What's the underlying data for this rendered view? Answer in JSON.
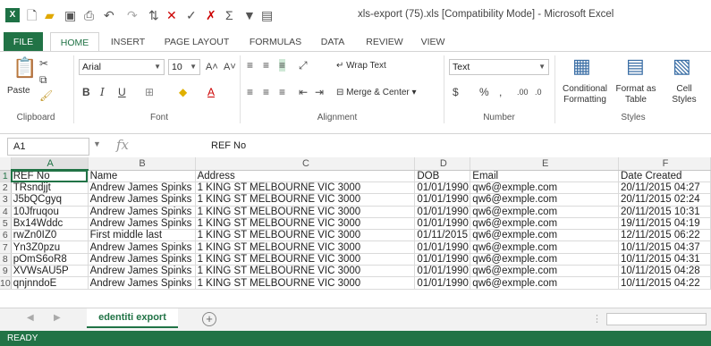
{
  "window": {
    "title": "xls-export (75).xls  [Compatibility Mode] - Microsoft Excel"
  },
  "ribbon_tabs": [
    "FILE",
    "HOME",
    "INSERT",
    "PAGE LAYOUT",
    "FORMULAS",
    "DATA",
    "REVIEW",
    "VIEW"
  ],
  "clipboard": {
    "paste": "Paste",
    "group": "Clipboard"
  },
  "font": {
    "name": "Arial",
    "size": "10",
    "bold": "B",
    "italic": "I",
    "underline": "U",
    "group": "Font"
  },
  "alignment": {
    "wrap": "Wrap Text",
    "merge": "Merge & Center",
    "group": "Alignment"
  },
  "number": {
    "format": "Text",
    "currency": "$",
    "percent": "%",
    "comma": ",",
    "group": "Number"
  },
  "styles": {
    "conditional": "Conditional",
    "conditional2": "Formatting",
    "format_table": "Format as",
    "format_table2": "Table",
    "cell": "Cell",
    "cell2": "Styles",
    "group": "Styles"
  },
  "formula_bar": {
    "name_box": "A1",
    "fx": "fx",
    "content": "REF No"
  },
  "columns": [
    "A",
    "B",
    "C",
    "D",
    "E",
    "F"
  ],
  "rows": [
    [
      "REF No",
      "Name",
      "Address",
      "DOB",
      "Email",
      "Date Created"
    ],
    [
      "TRsndjjt",
      "Andrew James Spinks",
      "1 KING ST MELBOURNE VIC 3000",
      "01/01/1990",
      "qw6@exmple.com",
      "20/11/2015 04:27"
    ],
    [
      "J5bQCgyq",
      "Andrew James Spinks",
      "1 KING ST MELBOURNE VIC 3000",
      "01/01/1990",
      "qw6@exmple.com",
      "20/11/2015 02:24"
    ],
    [
      "10Jfruqou",
      "Andrew James Spinks",
      "1 KING ST MELBOURNE VIC 3000",
      "01/01/1990",
      "qw6@exmple.com",
      "20/11/2015 10:31"
    ],
    [
      "Bx14Wddc",
      "Andrew James Spinks",
      "1 KING ST MELBOURNE VIC 3000",
      "01/01/1990",
      "qw6@exmple.com",
      "19/11/2015 04:19"
    ],
    [
      "rwZn0IZ0",
      "First middle last",
      "1 KING ST MELBOURNE VIC 3000",
      "01/11/2015",
      "qw6@exmple.com",
      "12/11/2015 06:22"
    ],
    [
      "Yn3Z0pzu",
      "Andrew James Spinks",
      "1 KING ST MELBOURNE VIC 3000",
      "01/01/1990",
      "qw6@exmple.com",
      "10/11/2015 04:37"
    ],
    [
      "pOmS6oR8",
      "Andrew James Spinks",
      "1 KING ST MELBOURNE VIC 3000",
      "01/01/1990",
      "qw6@exmple.com",
      "10/11/2015 04:31"
    ],
    [
      "XVWsAU5P",
      "Andrew James Spinks",
      "1 KING ST MELBOURNE VIC 3000",
      "01/01/1990",
      "qw6@exmple.com",
      "10/11/2015 04:28"
    ],
    [
      "qnjnndoE",
      "Andrew James Spinks",
      "1 KING ST MELBOURNE VIC 3000",
      "01/01/1990",
      "qw6@exmple.com",
      "10/11/2015 04:22"
    ]
  ],
  "sheet": {
    "tab": "edentiti export",
    "add": "+"
  },
  "status": "READY"
}
